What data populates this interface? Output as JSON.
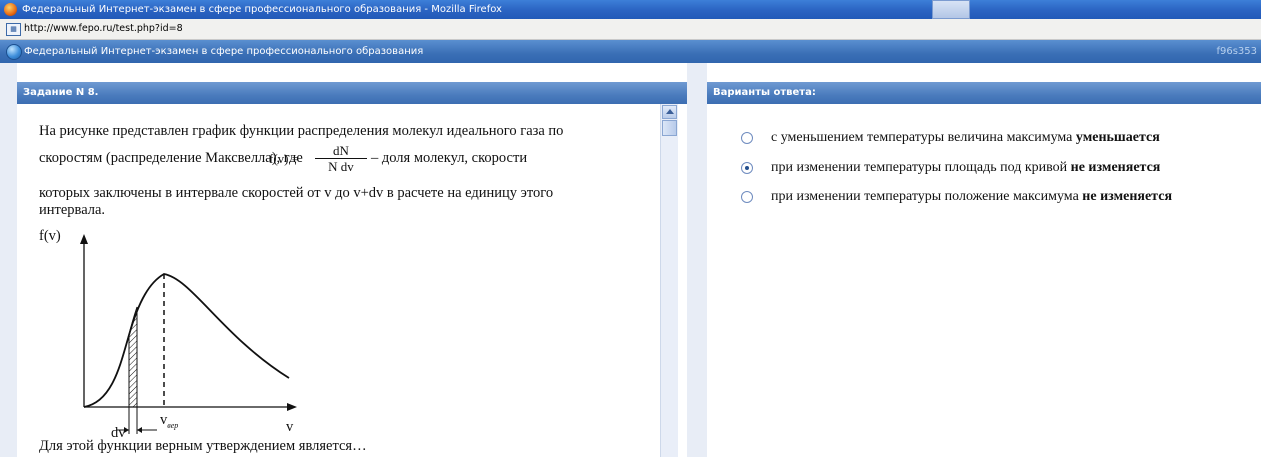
{
  "window": {
    "title": "Федеральный Интернет-экзамен в сфере профессионального образования - Mozilla Firefox"
  },
  "address_bar": {
    "url": "http://www.fepo.ru/test.php?id=8"
  },
  "app_header": {
    "title": "Федеральный Интернет-экзамен в сфере профессионального образования",
    "code": "f96s353"
  },
  "task": {
    "header": "Задание N 8.",
    "text_line1": "На рисунке представлен график функции распределения молекул идеального газа по",
    "text_line2_before": "скоростям (распределение Максвелла), где",
    "formula_lhs": "f(v) =",
    "formula_num": "dN",
    "formula_den": "N dv",
    "text_line2_after": "– доля молекул, скорости",
    "text_line3": "которых заключены в интервале скоростей от v до v+dv в расчете на единицу этого",
    "text_line4": "интервала.",
    "graph": {
      "y_label": "f(v)",
      "x_label": "v",
      "dv_label": "dv",
      "vmax_label": "v",
      "vmax_sub": "вер"
    },
    "question": "Для этой функции верным утверждением является…"
  },
  "answers": {
    "header": "Варианты ответа:",
    "options": [
      {
        "text": "с уменьшением температуры величина максимума ",
        "bold": "уменьшается",
        "selected": false
      },
      {
        "text": "при изменении температуры площадь под кривой ",
        "bold": "не изменяется",
        "selected": true
      },
      {
        "text": "при изменении температуры положение максимума ",
        "bold": "не изменяется",
        "selected": false
      }
    ]
  },
  "colors": {
    "titlebar": "#2a63c2",
    "header_blue": "#3c6eb2",
    "background_border": "#e8edf6"
  }
}
